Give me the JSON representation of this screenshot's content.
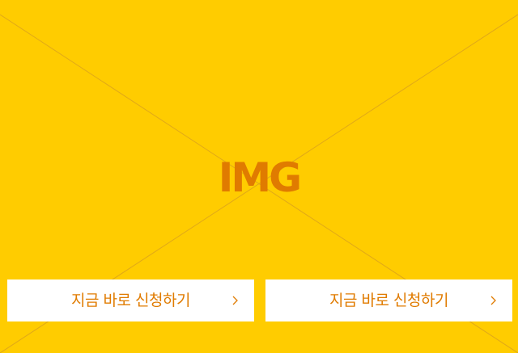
{
  "placeholder": {
    "label": "IMG",
    "background_color": "#ffcc00",
    "accent_color": "#e07b00"
  },
  "actions": [
    {
      "label": "지금 바로 신청하기",
      "icon": "chevron-right-icon"
    },
    {
      "label": "지금 바로 신청하기",
      "icon": "chevron-right-icon"
    }
  ]
}
